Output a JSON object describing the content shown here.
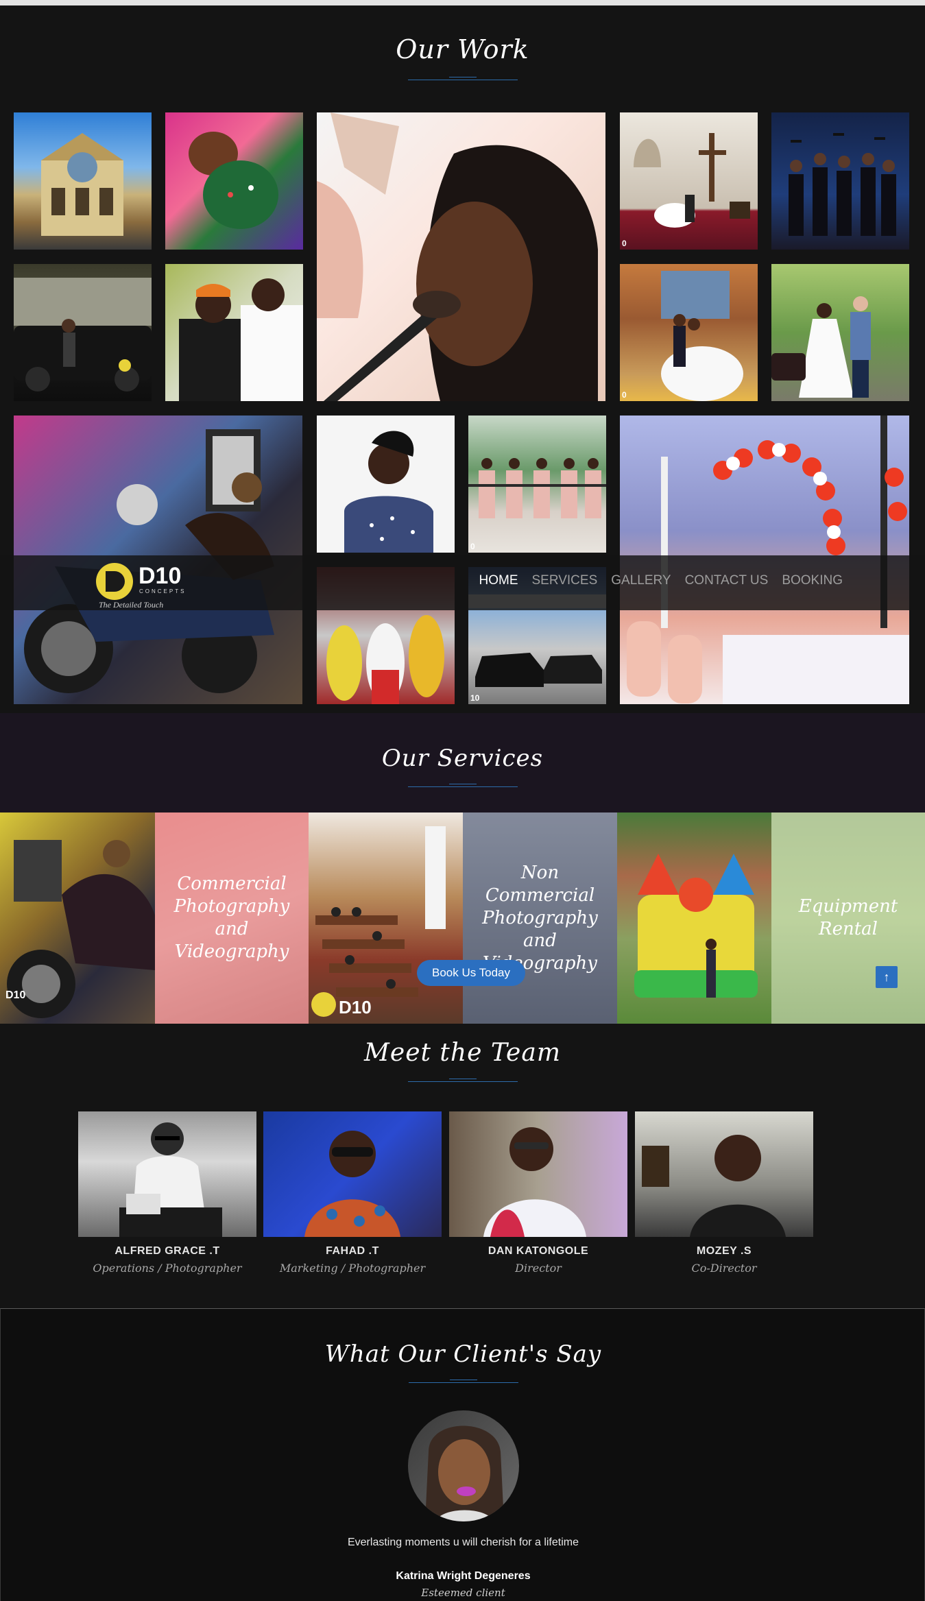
{
  "work": {
    "title": "Our Work",
    "tile_captions": {
      "wedding_altar": "0",
      "wedding_gallery": "0",
      "bridesmaids": "0",
      "cars": "10"
    }
  },
  "nav": {
    "logo_text": "D10",
    "logo_subtext": "CONCEPTS",
    "logo_tagline": "The Detailed Touch",
    "items": [
      {
        "label": "HOME",
        "active": true
      },
      {
        "label": "SERVICES",
        "active": false
      },
      {
        "label": "GALLERY",
        "active": false
      },
      {
        "label": "CONTACT US",
        "active": false
      },
      {
        "label": "BOOKING",
        "active": false
      }
    ]
  },
  "services": {
    "title": "Our Services",
    "items": [
      {
        "label": "Commercial Photography and Videography"
      },
      {
        "label": "Non Commercial Photography and Videography"
      },
      {
        "label": "Equipment Rental"
      }
    ],
    "book_button": "Book Us Today",
    "photo_logos": [
      "D10",
      "D10"
    ],
    "back_to_top": "↑"
  },
  "team": {
    "title": "Meet the Team",
    "members": [
      {
        "name": "ALFRED GRACE .T",
        "role": "Operations / Photographer"
      },
      {
        "name": "FAHAD .T",
        "role": "Marketing / Photographer"
      },
      {
        "name": "DAN KATONGOLE",
        "role": "Director"
      },
      {
        "name": "MOZEY .S",
        "role": "Co-Director"
      }
    ]
  },
  "testimonials": {
    "title": "What Our Client's Say",
    "quote": "Everlasting moments u will cherish for a lifetime",
    "client_name": "Katrina Wright Degeneres",
    "client_role": "Esteemed client"
  },
  "colors": {
    "accent": "#2b6fc0",
    "background": "#141414",
    "logo_yellow": "#e8d23a"
  }
}
